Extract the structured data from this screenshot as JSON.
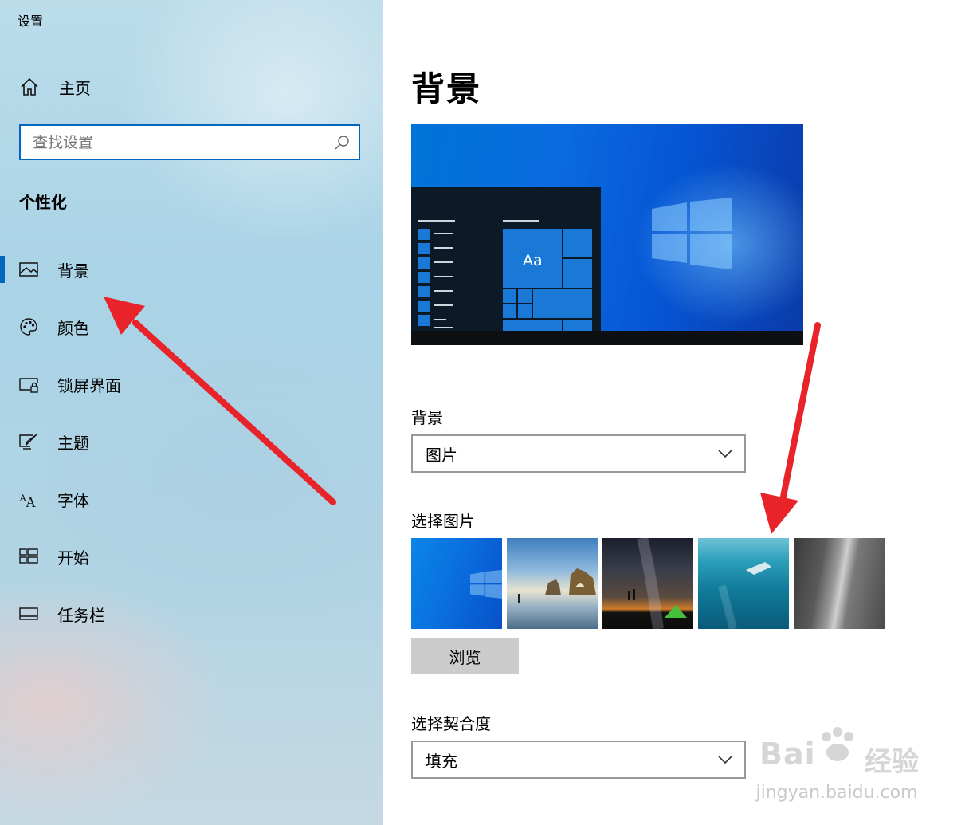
{
  "app": {
    "title": "设置"
  },
  "sidebar": {
    "home_label": "主页",
    "search_placeholder": "查找设置",
    "section_title": "个性化",
    "items": [
      {
        "label": "背景",
        "icon": "picture-icon",
        "active": true
      },
      {
        "label": "颜色",
        "icon": "palette-icon"
      },
      {
        "label": "锁屏界面",
        "icon": "lock-screen-icon"
      },
      {
        "label": "主题",
        "icon": "theme-brush-icon"
      },
      {
        "label": "字体",
        "icon": "font-icon"
      },
      {
        "label": "开始",
        "icon": "start-grid-icon"
      },
      {
        "label": "任务栏",
        "icon": "taskbar-icon"
      }
    ]
  },
  "main": {
    "title": "背景",
    "preview": {
      "sample_text": "Aa"
    },
    "background": {
      "label": "背景",
      "value": "图片"
    },
    "choose_picture": {
      "label": "选择图片",
      "thumbnails": [
        "windows-blue-wallpaper",
        "beach-rock-arch-photo",
        "night-sky-tent-photo",
        "underwater-swimmer-photo",
        "rock-cliff-photo"
      ],
      "browse_label": "浏览"
    },
    "fit": {
      "label": "选择契合度",
      "value": "填充"
    }
  },
  "watermark": {
    "brand": "Bai",
    "brand_cn": "经验",
    "url": "jingyan.baidu.com"
  },
  "colors": {
    "accent": "#0067c0",
    "annotation_arrow": "#e8232a"
  }
}
